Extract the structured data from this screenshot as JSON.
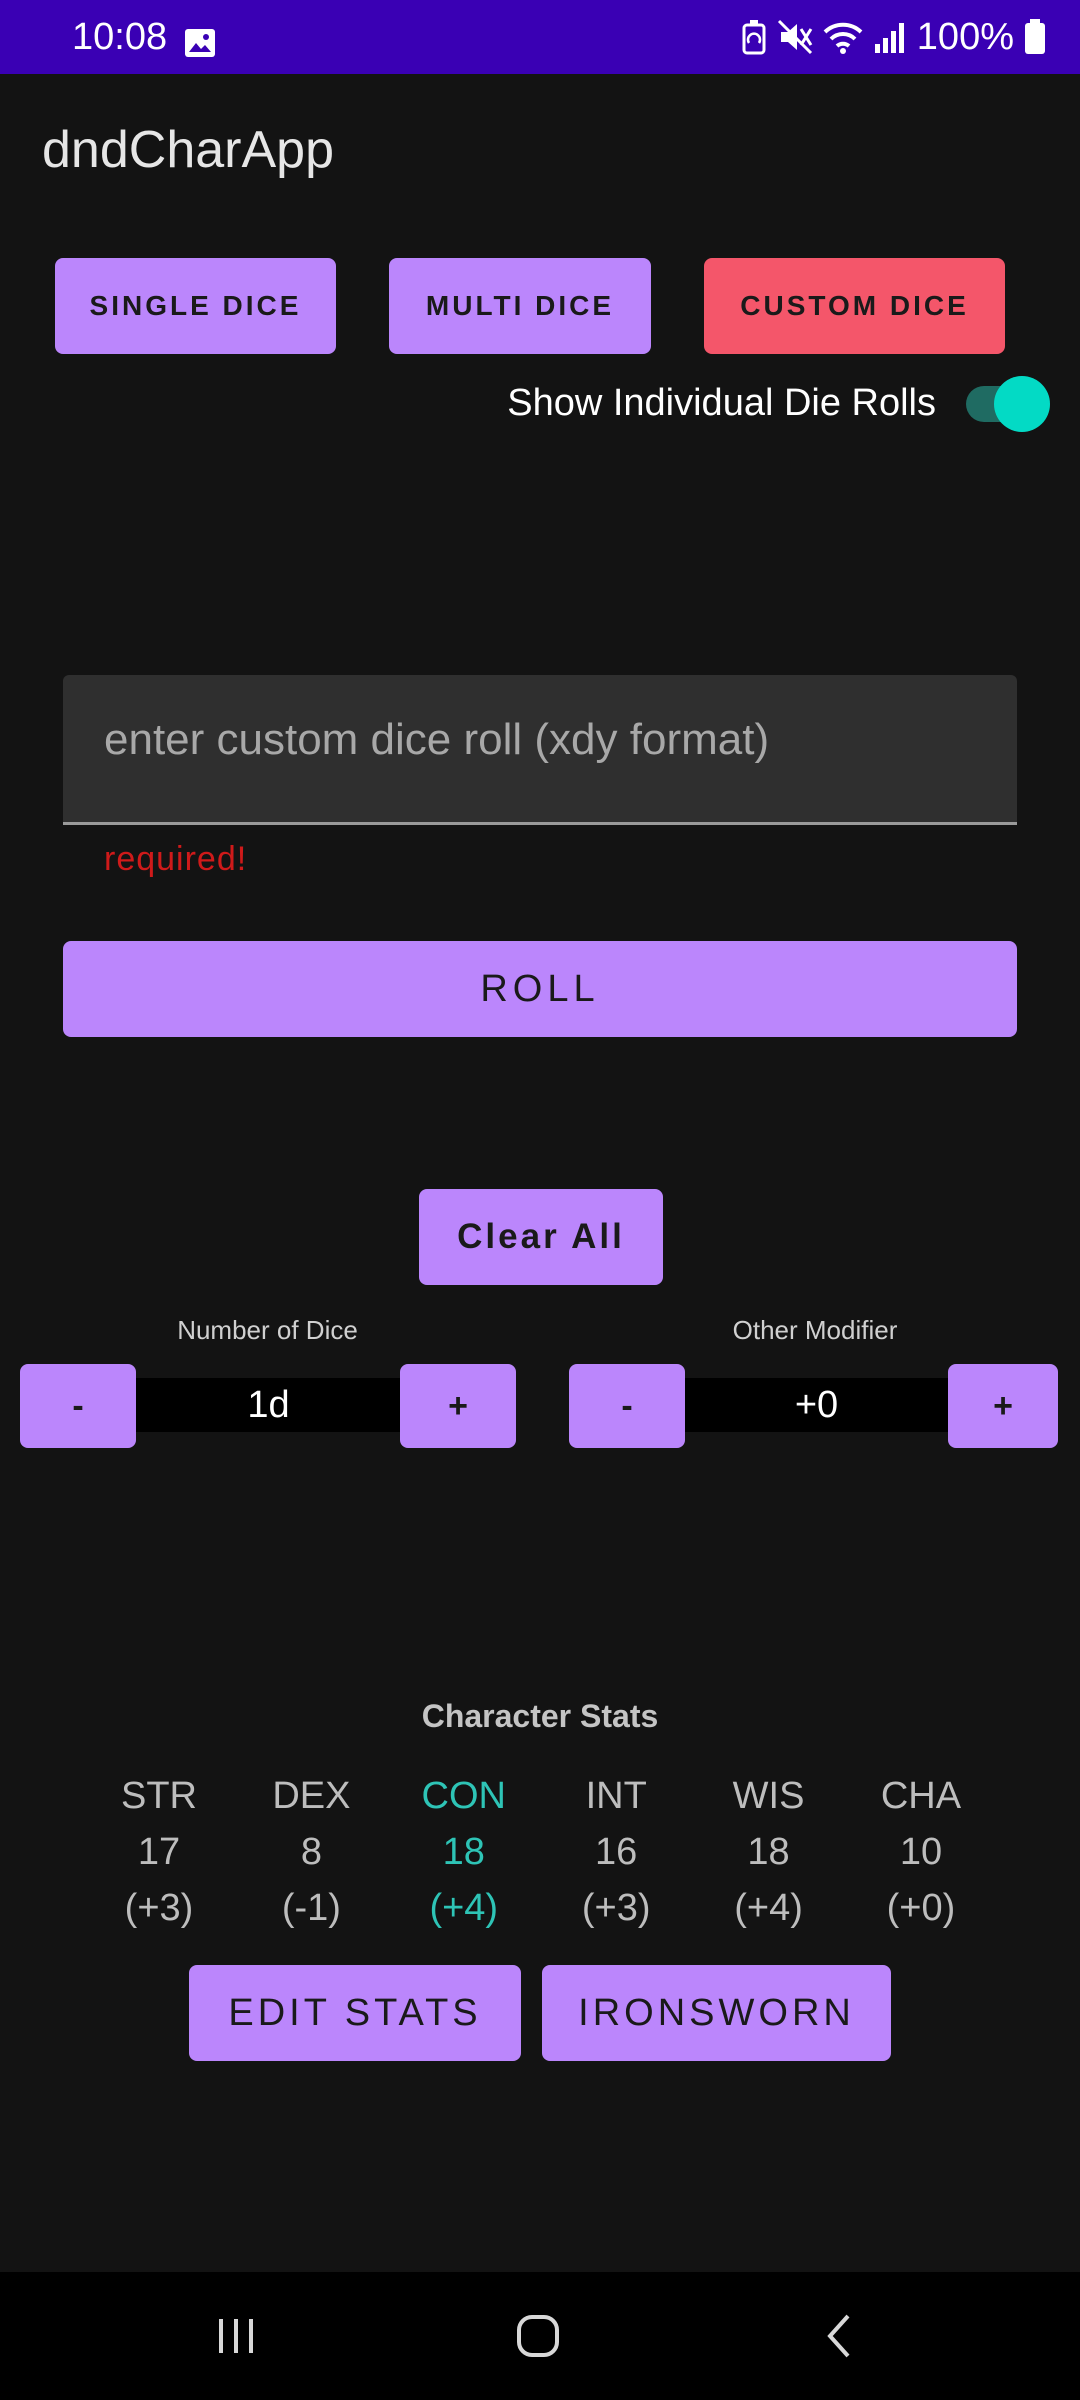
{
  "status_bar": {
    "time": "10:08",
    "battery": "100%",
    "icons": [
      "image-icon",
      "battery-saver-icon",
      "mute-icon",
      "wifi-icon",
      "signal-icon",
      "battery-icon"
    ]
  },
  "app": {
    "title": "dndCharApp"
  },
  "modes": {
    "single": "SINGLE DICE",
    "multi": "MULTI DICE",
    "custom": "CUSTOM DICE",
    "selected": "CUSTOM DICE"
  },
  "toggle": {
    "label": "Show Individual Die Rolls",
    "on": true
  },
  "custom_roll": {
    "placeholder": "enter custom dice roll (xdy format)",
    "value": "",
    "error": "required!"
  },
  "actions": {
    "roll": "ROLL",
    "clear_all": "Clear All"
  },
  "dice_stepper": {
    "label": "Number of Dice",
    "value": "1d",
    "minus": "-",
    "plus": "+"
  },
  "modifier_stepper": {
    "label": "Other Modifier",
    "value": "+0",
    "minus": "-",
    "plus": "+"
  },
  "stats": {
    "title": "Character Stats",
    "items": [
      {
        "name": "STR",
        "score": "17",
        "mod": "(+3)"
      },
      {
        "name": "DEX",
        "score": "8",
        "mod": "(-1)"
      },
      {
        "name": "CON",
        "score": "18",
        "mod": "(+4)"
      },
      {
        "name": "INT",
        "score": "16",
        "mod": "(+3)"
      },
      {
        "name": "WIS",
        "score": "18",
        "mod": "(+4)"
      },
      {
        "name": "CHA",
        "score": "10",
        "mod": "(+0)"
      }
    ],
    "highlighted": "CON"
  },
  "bottom_actions": {
    "edit_stats": "EDIT STATS",
    "ironsworn": "IRONSWORN"
  },
  "colors": {
    "status_bar": "#3a00b4",
    "primary": "#bb86fc",
    "selected_mode": "#f4566a",
    "accent": "#03dac5",
    "error": "#cf1a1a",
    "background": "#131313"
  },
  "nav_bar": {
    "icons": [
      "recent-apps-icon",
      "home-icon",
      "back-icon"
    ]
  }
}
